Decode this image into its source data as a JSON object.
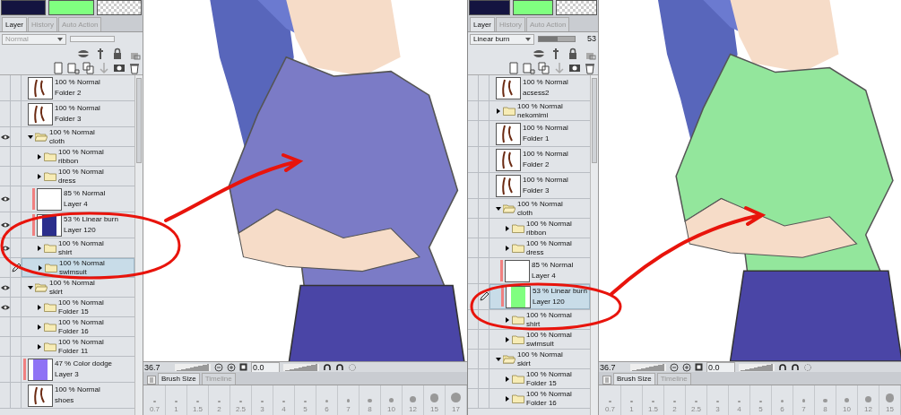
{
  "halves": [
    {
      "swatches": [
        {
          "kind": "color",
          "color": "#141440"
        },
        {
          "kind": "color",
          "color": "#80ff80"
        },
        {
          "kind": "transparent"
        }
      ],
      "tabs": [
        {
          "label": "Layer",
          "selected": true
        },
        {
          "label": "History",
          "selected": false
        },
        {
          "label": "Auto Action",
          "selected": false
        }
      ],
      "blend_mode": "Normal",
      "blend_disabled": true,
      "layers": [
        {
          "kind": "layer",
          "blend": "100 % Normal",
          "name": "Folder 2",
          "visible": false,
          "editing": false,
          "clipped": false,
          "selected": false
        },
        {
          "kind": "layer",
          "blend": "100 % Normal",
          "name": "Folder 3",
          "visible": false,
          "editing": false,
          "clipped": false,
          "selected": false
        },
        {
          "kind": "folder",
          "blend": "100 % Normal",
          "name": "cloth",
          "visible": true,
          "editing": false,
          "clipped": false,
          "selected": false,
          "expanded": true,
          "children": [
            {
              "kind": "folder",
              "blend": "100 % Normal",
              "name": "ribbon",
              "visible": false,
              "editing": false,
              "clipped": false,
              "selected": false,
              "expanded": false
            },
            {
              "kind": "folder",
              "blend": "100 % Normal",
              "name": "dress",
              "visible": false,
              "editing": false,
              "clipped": false,
              "selected": false,
              "expanded": false
            },
            {
              "kind": "layer",
              "blend": "85 % Normal",
              "name": "Layer 4",
              "visible": true,
              "editing": false,
              "clipped": true,
              "selected": false,
              "color": "#ffffff"
            },
            {
              "kind": "layer",
              "blend": "53 % Linear burn",
              "name": "Layer 120",
              "visible": true,
              "editing": false,
              "clipped": true,
              "selected": false,
              "color": "#2b2e8c"
            },
            {
              "kind": "folder",
              "blend": "100 % Normal",
              "name": "shirt",
              "visible": true,
              "editing": false,
              "clipped": false,
              "selected": false,
              "expanded": false
            },
            {
              "kind": "folder",
              "blend": "100 % Normal",
              "name": "swimsuit",
              "visible": false,
              "editing": true,
              "clipped": false,
              "selected": true,
              "expanded": false
            }
          ]
        },
        {
          "kind": "folder",
          "blend": "100 % Normal",
          "name": "skirt",
          "visible": true,
          "editing": false,
          "clipped": false,
          "selected": false,
          "expanded": true,
          "children": [
            {
              "kind": "folder",
              "blend": "100 % Normal",
              "name": "Folder 15",
              "visible": true,
              "editing": false,
              "clipped": false,
              "selected": false,
              "expanded": false
            },
            {
              "kind": "folder",
              "blend": "100 % Normal",
              "name": "Folder 16",
              "visible": false,
              "editing": false,
              "clipped": false,
              "selected": false,
              "expanded": false
            },
            {
              "kind": "folder",
              "blend": "100 % Normal",
              "name": "Folder 11",
              "visible": false,
              "editing": false,
              "clipped": false,
              "selected": false,
              "expanded": false
            }
          ]
        },
        {
          "kind": "layer",
          "blend": "47 % Color dodge",
          "name": "Layer 3",
          "visible": false,
          "editing": false,
          "clipped": true,
          "selected": false,
          "color": "#8f73f5"
        },
        {
          "kind": "layer",
          "blend": "100 % Normal",
          "name": "shoes",
          "visible": false,
          "editing": false,
          "clipped": false,
          "selected": false
        }
      ],
      "status": {
        "zoom": "36.7",
        "zoom_slider": {
          "level": 0.95
        },
        "angle": "0.0",
        "rotation_slider": {
          "level": 0.95
        }
      },
      "bottom_tabs": [
        {
          "label": "Brush Size",
          "selected": true
        },
        {
          "label": "Timeline",
          "selected": false
        }
      ],
      "brush_sizes": [
        "0.7",
        "1",
        "1.5",
        "2",
        "2.5",
        "3",
        "4",
        "5",
        "6",
        "7",
        "8",
        "10",
        "12",
        "15",
        "17"
      ]
    },
    {
      "swatches": [
        {
          "kind": "color",
          "color": "#141440"
        },
        {
          "kind": "color",
          "color": "#80ff80"
        },
        {
          "kind": "transparent"
        }
      ],
      "tabs": [
        {
          "label": "Layer",
          "selected": true
        },
        {
          "label": "History",
          "selected": false
        },
        {
          "label": "Auto Action",
          "selected": false
        }
      ],
      "blend_mode": "Linear burn",
      "blend_disabled": false,
      "opacity": {
        "value": "53",
        "level": 0.53
      },
      "layers": [
        {
          "kind": "layer",
          "blend": "100 % Normal",
          "name": "acsess2",
          "visible": false,
          "editing": false,
          "clipped": false,
          "selected": false
        },
        {
          "kind": "folder",
          "blend": "100 % Normal",
          "name": "nekomimi",
          "visible": false,
          "editing": false,
          "clipped": false,
          "selected": false,
          "expanded": false
        },
        {
          "kind": "layer",
          "blend": "100 % Normal",
          "name": "Folder 1",
          "visible": false,
          "editing": false,
          "clipped": false,
          "selected": false
        },
        {
          "kind": "layer",
          "blend": "100 % Normal",
          "name": "Folder 2",
          "visible": false,
          "editing": false,
          "clipped": false,
          "selected": false
        },
        {
          "kind": "layer",
          "blend": "100 % Normal",
          "name": "Folder 3",
          "visible": false,
          "editing": false,
          "clipped": false,
          "selected": false
        },
        {
          "kind": "folder",
          "blend": "100 % Normal",
          "name": "cloth",
          "visible": false,
          "editing": false,
          "clipped": false,
          "selected": false,
          "expanded": true,
          "children": [
            {
              "kind": "folder",
              "blend": "100 % Normal",
              "name": "ribbon",
              "visible": false,
              "editing": false,
              "clipped": false,
              "selected": false,
              "expanded": false
            },
            {
              "kind": "folder",
              "blend": "100 % Normal",
              "name": "dress",
              "visible": false,
              "editing": false,
              "clipped": false,
              "selected": false,
              "expanded": false
            },
            {
              "kind": "layer",
              "blend": "85 % Normal",
              "name": "Layer 4",
              "visible": false,
              "editing": false,
              "clipped": true,
              "selected": false,
              "color": "#ffffff"
            },
            {
              "kind": "layer",
              "blend": "53 % Linear burn",
              "name": "Layer 120",
              "visible": false,
              "editing": true,
              "clipped": true,
              "selected": true,
              "color": "#80ff80"
            },
            {
              "kind": "folder",
              "blend": "100 % Normal",
              "name": "shirt",
              "visible": false,
              "editing": false,
              "clipped": false,
              "selected": false,
              "expanded": false
            },
            {
              "kind": "folder",
              "blend": "100 % Normal",
              "name": "swimsuit",
              "visible": false,
              "editing": false,
              "clipped": false,
              "selected": false,
              "expanded": false
            }
          ]
        },
        {
          "kind": "folder",
          "blend": "100 % Normal",
          "name": "skirt",
          "visible": false,
          "editing": false,
          "clipped": false,
          "selected": false,
          "expanded": true,
          "children": [
            {
              "kind": "folder",
              "blend": "100 % Normal",
              "name": "Folder 15",
              "visible": false,
              "editing": false,
              "clipped": false,
              "selected": false,
              "expanded": false
            },
            {
              "kind": "folder",
              "blend": "100 % Normal",
              "name": "Folder 16",
              "visible": false,
              "editing": false,
              "clipped": false,
              "selected": false,
              "expanded": false
            }
          ]
        }
      ],
      "status": {
        "zoom": "36.7",
        "zoom_slider": {
          "level": 0.95
        },
        "angle": "0.0",
        "rotation_slider": {
          "level": 0.95
        }
      },
      "bottom_tabs": [
        {
          "label": "Brush Size",
          "selected": true
        },
        {
          "label": "Timeline",
          "selected": false
        }
      ],
      "brush_sizes": [
        "0.7",
        "1",
        "1.5",
        "2",
        "2.5",
        "3",
        "4",
        "5",
        "6",
        "7",
        "8",
        "10",
        "12",
        "15"
      ]
    }
  ]
}
